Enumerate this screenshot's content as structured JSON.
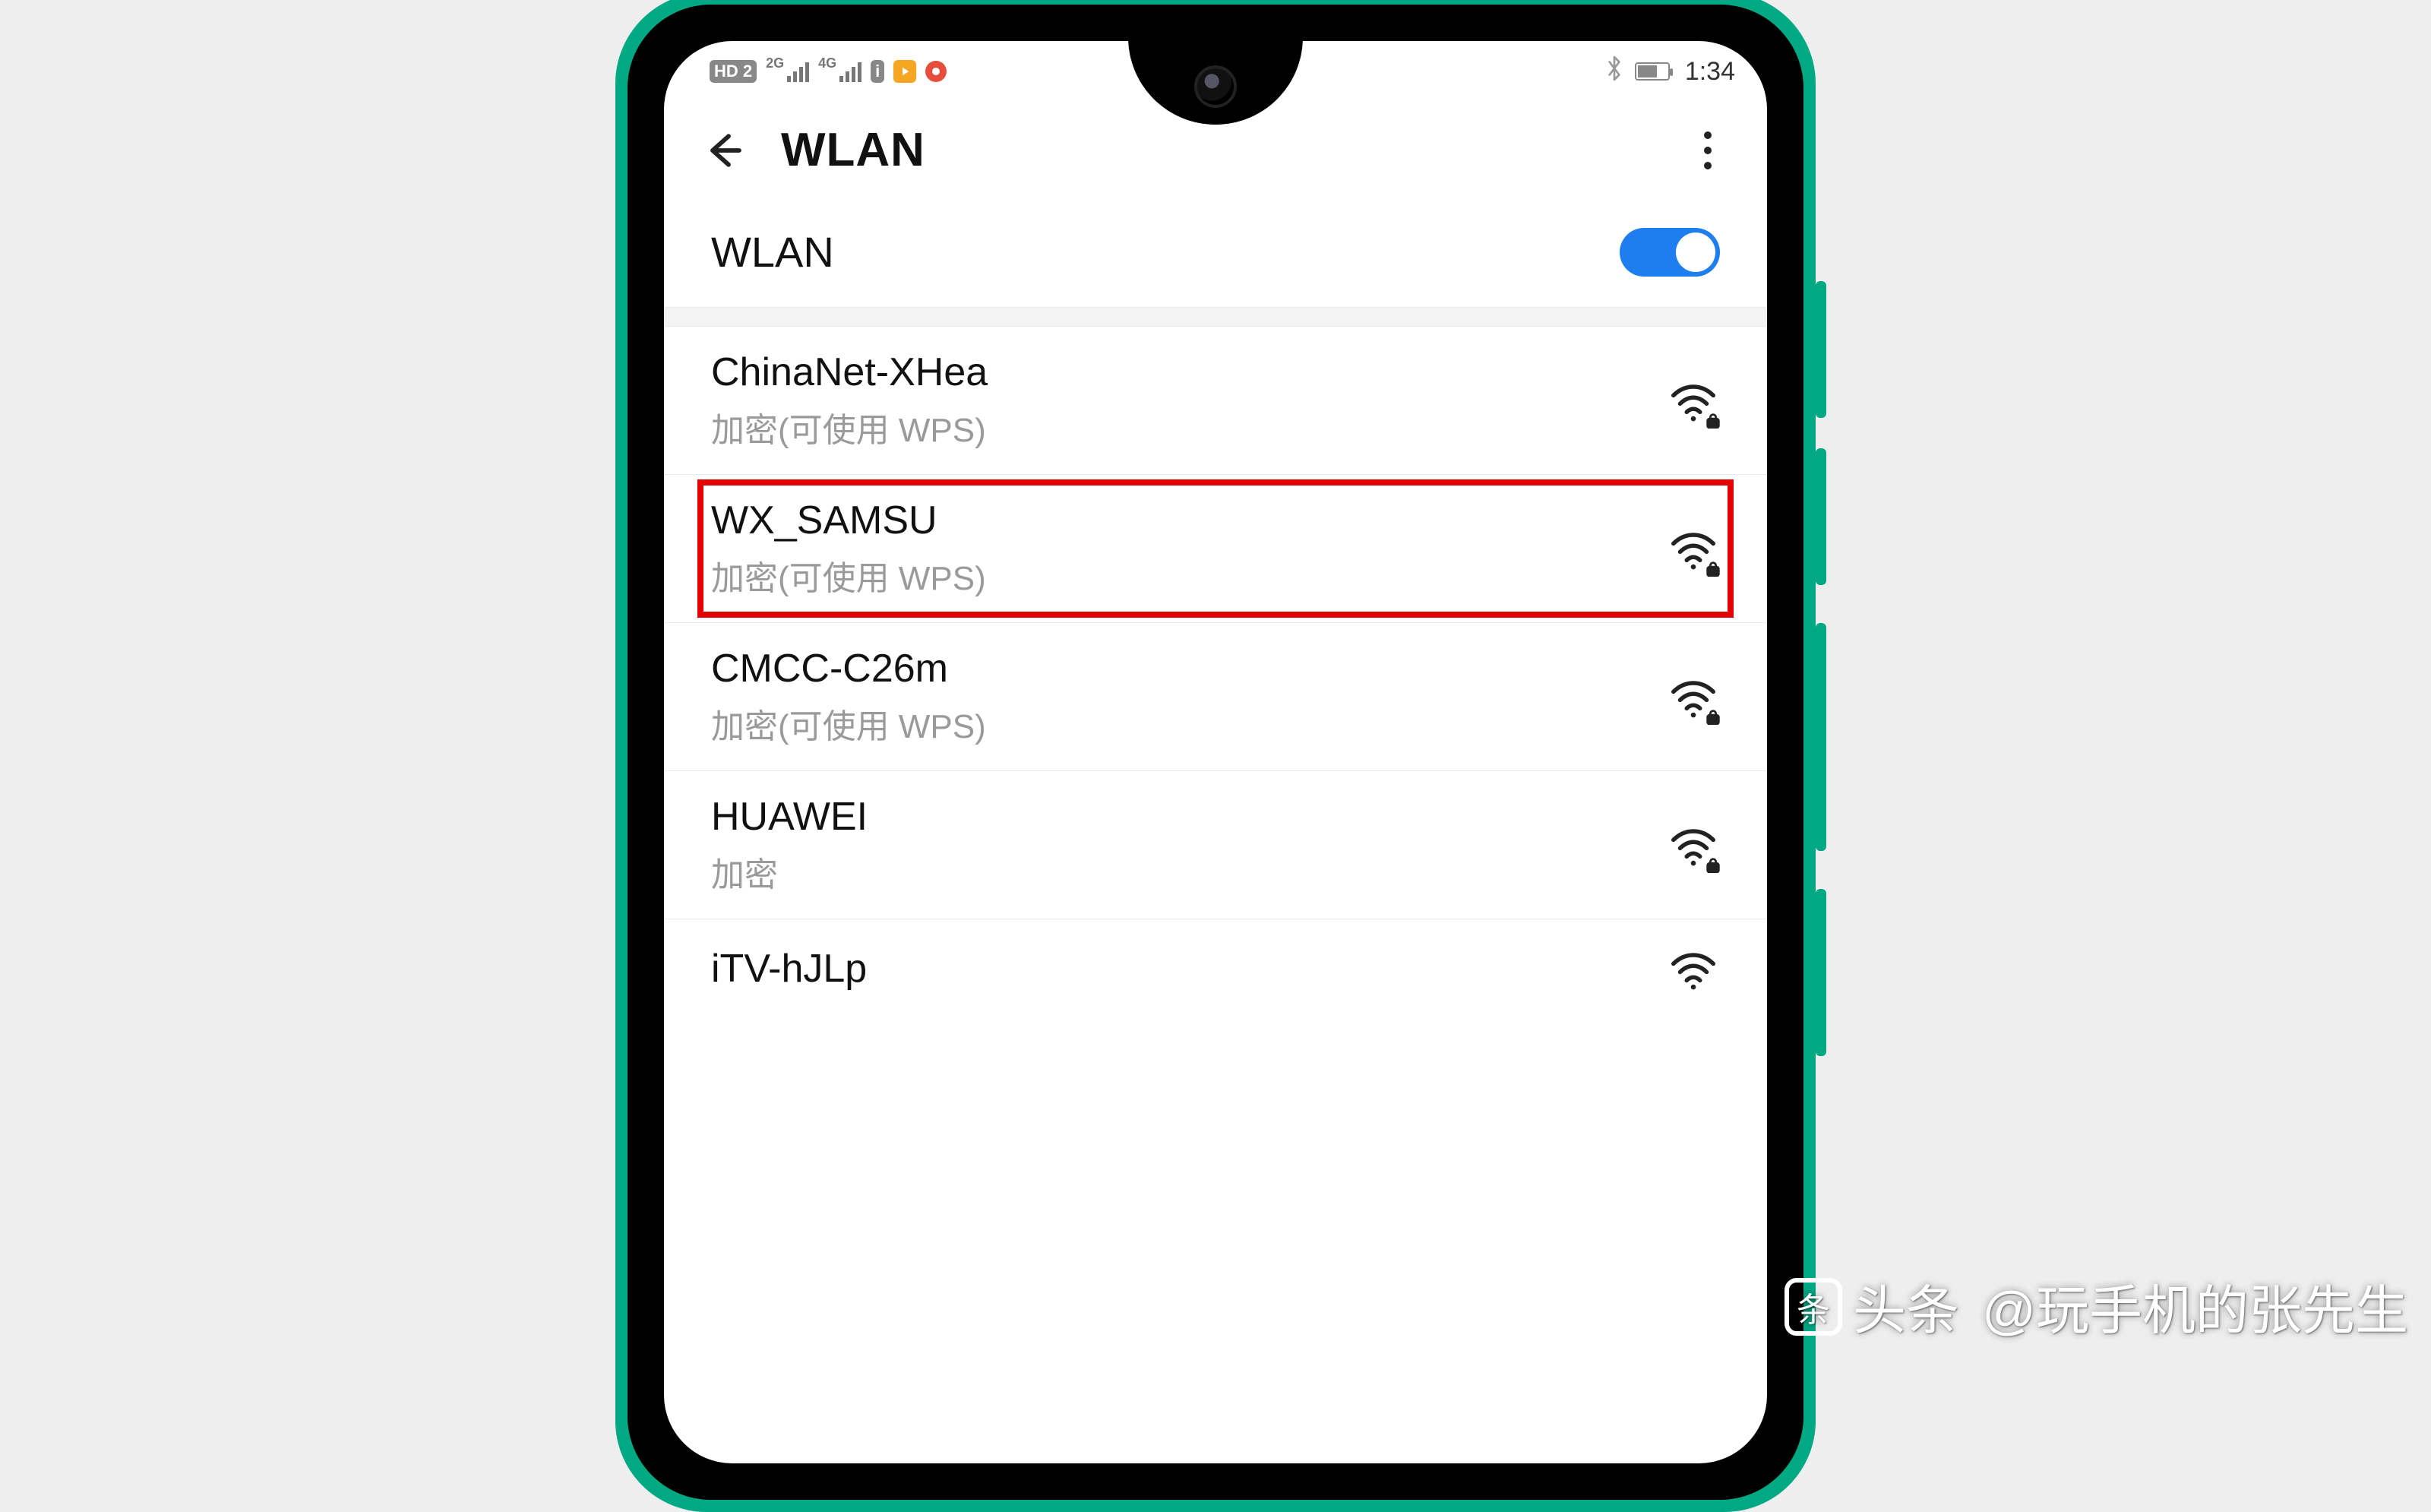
{
  "statusbar": {
    "hd_badge": "HD 2",
    "sig1_label": "2G",
    "sig2_label": "4G",
    "info_badge": "i",
    "time": "1:34"
  },
  "header": {
    "title": "WLAN"
  },
  "toggle": {
    "label": "WLAN",
    "on": true
  },
  "networks": [
    {
      "ssid": "ChinaNet-XHea",
      "subtitle": "加密(可使用 WPS)",
      "locked": true,
      "highlighted": false
    },
    {
      "ssid": "WX_SAMSU",
      "subtitle": "加密(可使用 WPS)",
      "locked": true,
      "highlighted": true
    },
    {
      "ssid": "CMCC-C26m",
      "subtitle": "加密(可使用 WPS)",
      "locked": true,
      "highlighted": false
    },
    {
      "ssid": "HUAWEI",
      "subtitle": "加密",
      "locked": true,
      "highlighted": false
    },
    {
      "ssid": "iTV-hJLp",
      "subtitle": "",
      "locked": false,
      "highlighted": false
    }
  ],
  "watermark": {
    "brand": "头条",
    "handle": "@玩手机的张先生"
  }
}
